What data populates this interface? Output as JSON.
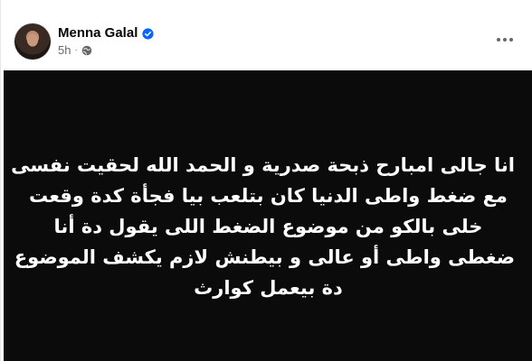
{
  "post": {
    "author_name": "Menna Galal",
    "verified_icon": "verified-badge-icon",
    "timestamp": "5h",
    "separator": "·",
    "audience_icon": "globe-icon",
    "more_icon": "more-options-icon",
    "text_lines": [
      "انا جالى امبارح ذبحة صدرية و الحمد الله لحقيت نفسى",
      "مع ضغط واطى الدنيا كان بتلعب بيا فجأة كدة وقعت",
      "خلى بالكو من موضوع الضغط اللى يقول دة أنا",
      "ضغطى واطى أو عالى و بيطنش لازم يكشف الموضوع",
      "دة بيعمل كوارث"
    ],
    "background_color": "#0b0b0b",
    "text_color": "#ffffff"
  },
  "colors": {
    "verified": "#0866ff",
    "meta_text": "#65676b"
  }
}
